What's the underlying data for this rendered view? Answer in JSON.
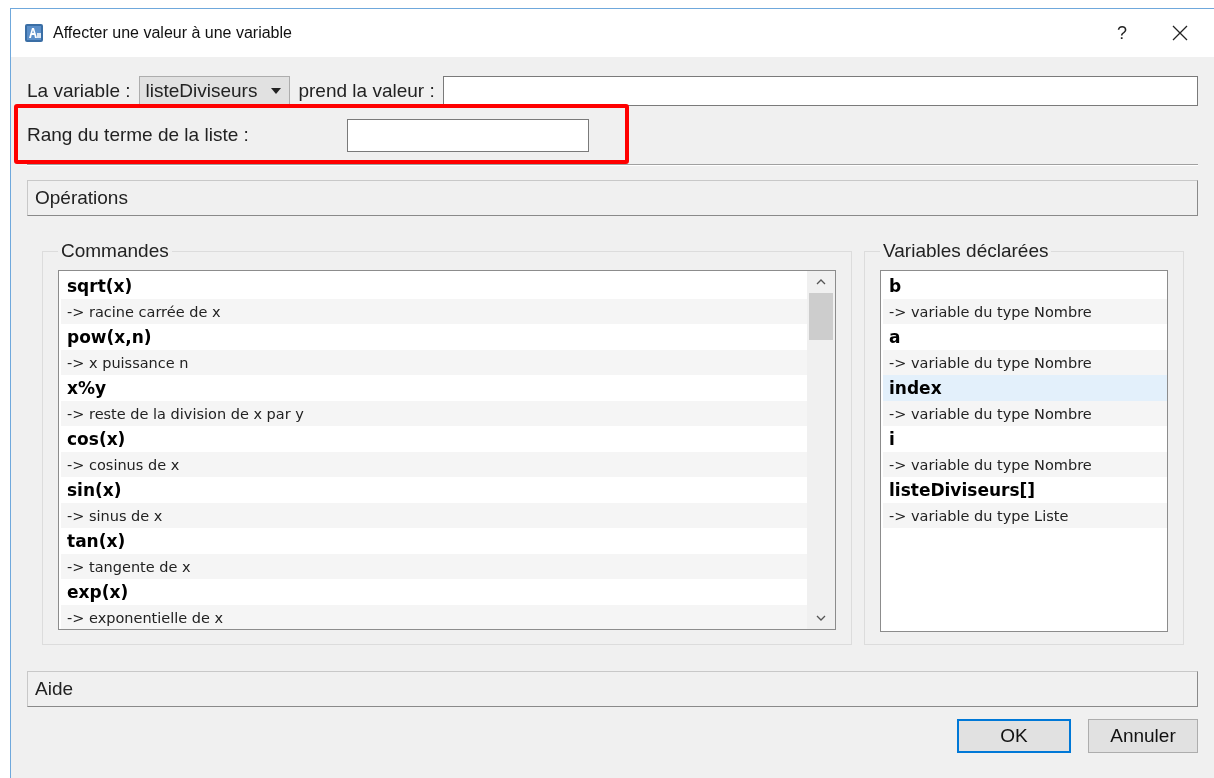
{
  "window": {
    "title": "Affecter une valeur à une variable",
    "help": "?"
  },
  "variable_row": {
    "label": "La variable :",
    "dropdown": "listeDiviseurs",
    "value_label": "prend la valeur :"
  },
  "rank_row": {
    "label": "Rang du terme de la liste :"
  },
  "operations": {
    "label": "Opérations"
  },
  "commands": {
    "title": "Commandes",
    "items": [
      {
        "name": "sqrt(x)",
        "description": "-> racine carrée de x"
      },
      {
        "name": "pow(x,n)",
        "description": "-> x puissance n"
      },
      {
        "name": "x%y",
        "description": "-> reste de la division de x par y"
      },
      {
        "name": "cos(x)",
        "description": "-> cosinus de x"
      },
      {
        "name": "sin(x)",
        "description": "-> sinus de x"
      },
      {
        "name": "tan(x)",
        "description": "-> tangente de x"
      },
      {
        "name": "exp(x)",
        "description": "-> exponentielle de x"
      }
    ]
  },
  "variables": {
    "title": "Variables déclarées",
    "items": [
      {
        "name": "b",
        "description": "-> variable du type Nombre",
        "selected": false
      },
      {
        "name": "a",
        "description": "-> variable du type Nombre",
        "selected": false
      },
      {
        "name": "index",
        "description": "-> variable du type Nombre",
        "selected": true
      },
      {
        "name": "i",
        "description": "-> variable du type Nombre",
        "selected": false
      },
      {
        "name": "listeDiviseurs[]",
        "description": "-> variable du type Liste",
        "selected": false
      }
    ]
  },
  "help_section": {
    "label": "Aide"
  },
  "buttons": [
    {
      "label": "OK",
      "kind": "default"
    },
    {
      "label": "Annuler",
      "kind": "normal"
    }
  ]
}
